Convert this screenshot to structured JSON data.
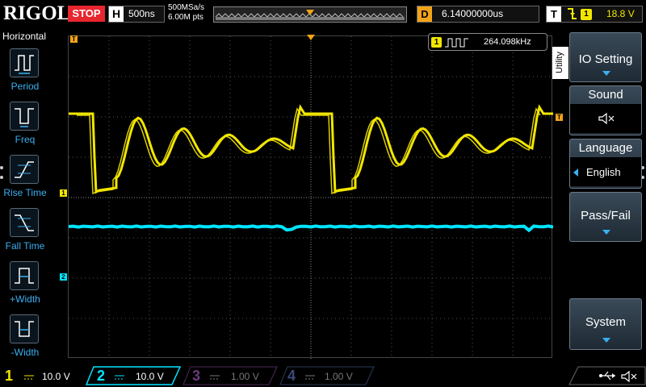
{
  "header": {
    "brand": "RIGOL",
    "run_state": "STOP",
    "timebase_letter": "H",
    "timebase_value": "500ns",
    "sample_rate": "500MSa/s",
    "memory_depth": "6.00M pts",
    "delay_letter": "D",
    "delay_value": "6.14000000us",
    "trigger_letter": "T",
    "trigger_source": "1",
    "trigger_level": "18.8 V"
  },
  "horizontal_menu": {
    "title": "Horizontal",
    "items": [
      {
        "label": "Period",
        "icon": "period-icon"
      },
      {
        "label": "Freq",
        "icon": "freq-icon"
      },
      {
        "label": "Rise Time",
        "icon": "rise-time-icon"
      },
      {
        "label": "Fall Time",
        "icon": "fall-time-icon"
      },
      {
        "label": "+Width",
        "icon": "pos-width-icon"
      },
      {
        "label": "-Width",
        "icon": "neg-width-icon"
      }
    ]
  },
  "measurement": {
    "channel": "1",
    "value": "264.098kHz"
  },
  "markers": {
    "trigger": "T",
    "ch1": "1",
    "ch2": "2"
  },
  "right_menu": {
    "tab": "Utility",
    "io_setting": "IO Setting",
    "sound": "Sound",
    "language": "Language",
    "language_value": "English",
    "pass_fail": "Pass/Fail",
    "system": "System"
  },
  "channels": [
    {
      "num": "1",
      "scale": "10.0 V",
      "color": "#f2e600",
      "active": true
    },
    {
      "num": "2",
      "scale": "10.0 V",
      "color": "#00e5ff",
      "active": true
    },
    {
      "num": "3",
      "scale": "1.00 V",
      "color": "#c03cff",
      "active": false
    },
    {
      "num": "4",
      "scale": "1.00 V",
      "color": "#2a6cff",
      "active": false
    }
  ],
  "colors": {
    "ch1": "#f2e600",
    "ch2": "#00e5ff",
    "accent": "#3ab0f0",
    "stop": "#e8262e",
    "delay": "#f2a31a"
  }
}
